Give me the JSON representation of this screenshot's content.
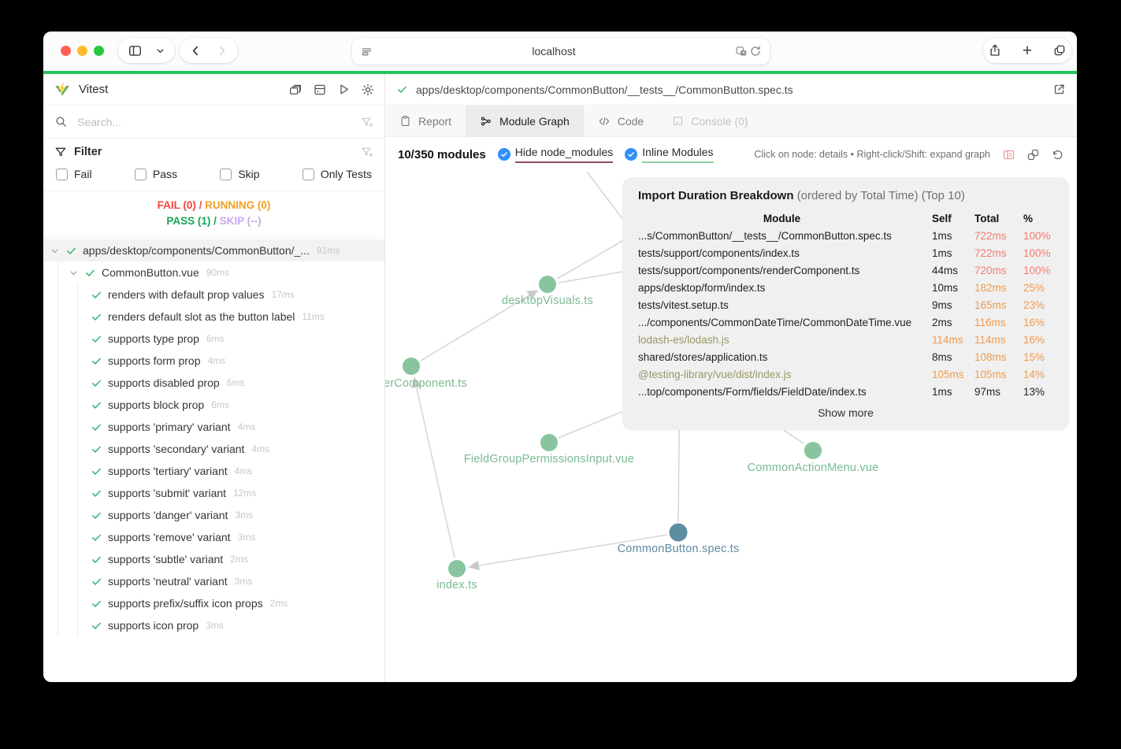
{
  "colors": {
    "accent_green_bar": "#24c35e",
    "node_green": "#88c49e",
    "node_focus_teal": "#5c8ea0",
    "label_green": "#79bb90",
    "label_focus": "#5d8ba1",
    "hot_red": "#f47c71",
    "warm_orange": "#f09b4c",
    "external_olive": "#999766",
    "checkbox_blue": "#2e90fa",
    "underline_maroon": "#8d4a5f",
    "underline_green": "#8fcfa4",
    "fail_red": "#f4453d",
    "running_amber": "#f0a020",
    "pass_green": "#17a556",
    "skip_lavender": "#c9a7f2"
  },
  "icons": [
    "sidebar-toggle-icon",
    "chevron-down-icon",
    "back-icon",
    "forward-icon",
    "reader-icon",
    "extensions-badge-icon",
    "reload-icon",
    "share-icon",
    "new-tab-icon",
    "tab-overview-icon",
    "vitest-logo",
    "windows-icon",
    "panel-icon",
    "run-all-icon",
    "theme-toggle-icon",
    "search-icon",
    "filter-icon",
    "filter-clear-icon",
    "check-icon",
    "clipboard-icon",
    "graph-icon",
    "code-icon",
    "console-icon",
    "external-link-icon",
    "table-icon",
    "chain-icon",
    "reset-icon"
  ],
  "browser": {
    "url": "localhost",
    "plus": "+"
  },
  "sidebar": {
    "title": "Vitest",
    "search_placeholder": "Search...",
    "filter": {
      "label": "Filter",
      "options": [
        {
          "label": "Fail"
        },
        {
          "label": "Pass"
        },
        {
          "label": "Skip"
        },
        {
          "label": "Only Tests"
        }
      ]
    },
    "summary": {
      "fail": "FAIL (0)",
      "running": "RUNNING (0)",
      "pass": "PASS (1)",
      "skip": "SKIP (--)",
      "sep": "/"
    },
    "tree": {
      "file": {
        "label": "apps/desktop/components/CommonButton/_...",
        "time": "91ms"
      },
      "suite": {
        "label": "CommonButton.vue",
        "time": "90ms"
      },
      "tests": [
        {
          "label": "renders with default prop values",
          "time": "17ms"
        },
        {
          "label": "renders default slot as the button label",
          "time": "11ms"
        },
        {
          "label": "supports type prop",
          "time": "6ms"
        },
        {
          "label": "supports form prop",
          "time": "4ms"
        },
        {
          "label": "supports disabled prop",
          "time": "6ms"
        },
        {
          "label": "supports block prop",
          "time": "6ms"
        },
        {
          "label": "supports 'primary' variant",
          "time": "4ms"
        },
        {
          "label": "supports 'secondary' variant",
          "time": "4ms"
        },
        {
          "label": "supports 'tertiary' variant",
          "time": "4ms"
        },
        {
          "label": "supports 'submit' variant",
          "time": "12ms"
        },
        {
          "label": "supports 'danger' variant",
          "time": "3ms"
        },
        {
          "label": "supports 'remove' variant",
          "time": "3ms"
        },
        {
          "label": "supports 'subtle' variant",
          "time": "2ms"
        },
        {
          "label": "supports 'neutral' variant",
          "time": "3ms"
        },
        {
          "label": "supports prefix/suffix icon props",
          "time": "2ms"
        },
        {
          "label": "supports icon prop",
          "time": "3ms"
        }
      ]
    }
  },
  "main": {
    "breadcrumb": "apps/desktop/components/CommonButton/__tests__/CommonButton.spec.ts",
    "tabs": {
      "report": "Report",
      "module_graph": "Module Graph",
      "code": "Code",
      "console": "Console (0)"
    },
    "toolbar": {
      "modules_count": "10/350 modules",
      "hide_node_modules": "Hide node_modules",
      "inline_modules": "Inline Modules",
      "hint": "Click on node: details • Right-click/Shift: expand graph"
    },
    "graph": {
      "nodes": [
        {
          "label": "desktopVisuals.ts"
        },
        {
          "label": "erComponent.ts"
        },
        {
          "label": "FieldGroupPermissionsInput.vue"
        },
        {
          "label": "CommonActionMenu.vue"
        },
        {
          "label": "CommonButton.spec.ts"
        },
        {
          "label": "index.ts"
        }
      ]
    },
    "breakdown": {
      "title": "Import Duration Breakdown",
      "subtitle": "(ordered by Total Time) (Top 10)",
      "columns": {
        "module": "Module",
        "self": "Self",
        "total": "Total",
        "pct": "%"
      },
      "rows": [
        {
          "module": "...s/CommonButton/__tests__/CommonButton.spec.ts",
          "self": "1ms",
          "total": "722ms",
          "pct": "100%",
          "module_tone": "normal",
          "self_tone": "normal",
          "total_tone": "hot",
          "pct_tone": "hot"
        },
        {
          "module": "tests/support/components/index.ts",
          "self": "1ms",
          "total": "722ms",
          "pct": "100%",
          "module_tone": "normal",
          "self_tone": "normal",
          "total_tone": "hot",
          "pct_tone": "hot"
        },
        {
          "module": "tests/support/components/renderComponent.ts",
          "self": "44ms",
          "total": "720ms",
          "pct": "100%",
          "module_tone": "normal",
          "self_tone": "normal",
          "total_tone": "hot",
          "pct_tone": "hot"
        },
        {
          "module": "apps/desktop/form/index.ts",
          "self": "10ms",
          "total": "182ms",
          "pct": "25%",
          "module_tone": "normal",
          "self_tone": "normal",
          "total_tone": "warm",
          "pct_tone": "warm"
        },
        {
          "module": "tests/vitest.setup.ts",
          "self": "9ms",
          "total": "165ms",
          "pct": "23%",
          "module_tone": "normal",
          "self_tone": "normal",
          "total_tone": "warm",
          "pct_tone": "warm"
        },
        {
          "module": ".../components/CommonDateTime/CommonDateTime.vue",
          "self": "2ms",
          "total": "116ms",
          "pct": "16%",
          "module_tone": "normal",
          "self_tone": "normal",
          "total_tone": "warm",
          "pct_tone": "warm"
        },
        {
          "module": "lodash-es/lodash.js",
          "self": "114ms",
          "total": "114ms",
          "pct": "16%",
          "module_tone": "external",
          "self_tone": "warm",
          "total_tone": "warm",
          "pct_tone": "warm"
        },
        {
          "module": "shared/stores/application.ts",
          "self": "8ms",
          "total": "108ms",
          "pct": "15%",
          "module_tone": "normal",
          "self_tone": "normal",
          "total_tone": "warm",
          "pct_tone": "warm"
        },
        {
          "module": "@testing-library/vue/dist/index.js",
          "self": "105ms",
          "total": "105ms",
          "pct": "14%",
          "module_tone": "external",
          "self_tone": "warm",
          "total_tone": "warm",
          "pct_tone": "warm"
        },
        {
          "module": "...top/components/Form/fields/FieldDate/index.ts",
          "self": "1ms",
          "total": "97ms",
          "pct": "13%",
          "module_tone": "normal",
          "self_tone": "normal",
          "total_tone": "normal",
          "pct_tone": "normal"
        }
      ],
      "show_more": "Show more"
    }
  }
}
